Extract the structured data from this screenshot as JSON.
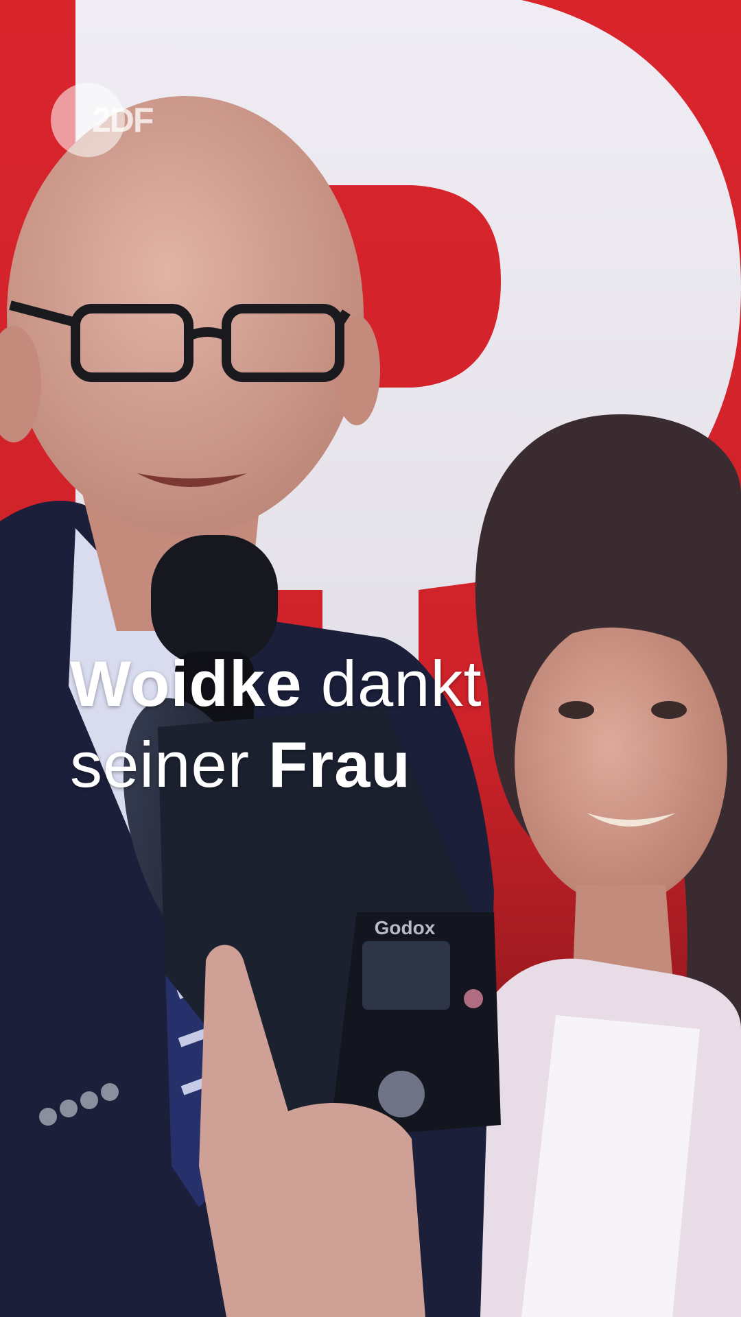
{
  "broadcaster": {
    "logo_text": "2DF",
    "icon": "zdf-logo-icon"
  },
  "caption": {
    "line1": {
      "emphasis": "Woidke",
      "rest": "dankt"
    },
    "line2": {
      "rest": "seiner",
      "emphasis": "Frau"
    }
  },
  "scene": {
    "brand_printed_on_device": "Godox",
    "colors": {
      "backdrop_red": "#d9242c",
      "backdrop_white": "#f1eef5",
      "suit_navy": "#1b1f3a",
      "skin": "#d6a597"
    }
  }
}
